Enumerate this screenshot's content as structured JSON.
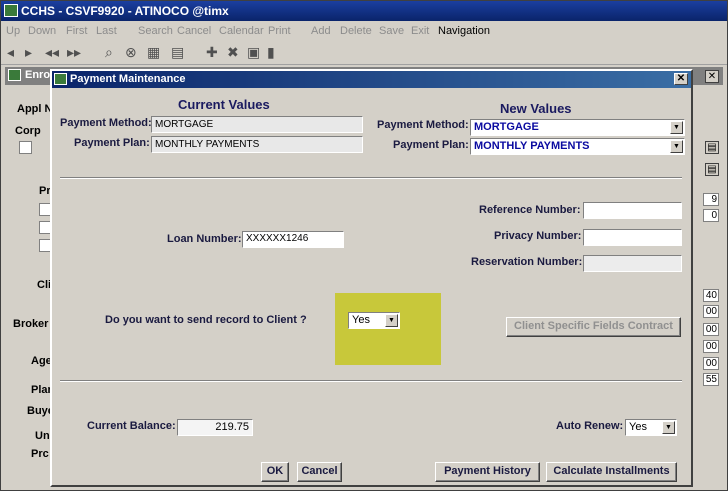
{
  "app": {
    "title": "CCHS - CSVF9920 - ATINOCO @timx",
    "menu": [
      "Up",
      "Down",
      "First",
      "Last",
      "Search",
      "Cancel",
      "Calendar",
      "Print",
      "Add",
      "Delete",
      "Save",
      "Exit",
      "Navigation"
    ]
  },
  "background": {
    "title": "Enro",
    "labels": [
      "Appl N",
      "Corp",
      "Pr",
      "Cli",
      "Broker",
      "Age",
      "Plar",
      "Buye",
      "Un",
      "Prc"
    ],
    "right_numbers": [
      "9",
      "0",
      "40",
      "00",
      "00",
      "00",
      "00",
      "55"
    ]
  },
  "dialog": {
    "title": "Payment Maintenance",
    "close": "✕",
    "current_header": "Current Values",
    "new_header": "New Values",
    "payment_method_label": "Payment Method:",
    "payment_plan_label": "Payment Plan:",
    "current_payment_method": "MORTGAGE",
    "current_payment_plan": "MONTHLY PAYMENTS",
    "new_payment_method": "MORTGAGE",
    "new_payment_plan": "MONTHLY PAYMENTS",
    "loan_number_label": "Loan Number:",
    "loan_number": "XXXXXX1246",
    "reference_number_label": "Reference Number:",
    "reference_number": "",
    "privacy_number_label": "Privacy Number:",
    "privacy_number": "",
    "reservation_number_label": "Reservation Number:",
    "reservation_number": "",
    "send_question": "Do you want to send record to Client ?",
    "send_value": "Yes",
    "client_fields_button": "Client Specific Fields Contract",
    "current_balance_label": "Current Balance:",
    "current_balance": "219.75",
    "auto_renew_label": "Auto Renew:",
    "auto_renew_value": "Yes",
    "ok_button": "OK",
    "cancel_button": "Cancel",
    "payment_history_button": "Payment History",
    "calculate_button": "Calculate Installments"
  },
  "colors": {
    "title_bar": "#0a246a",
    "highlight": "#c8c83a",
    "window_bg": "#d4d0c8"
  }
}
